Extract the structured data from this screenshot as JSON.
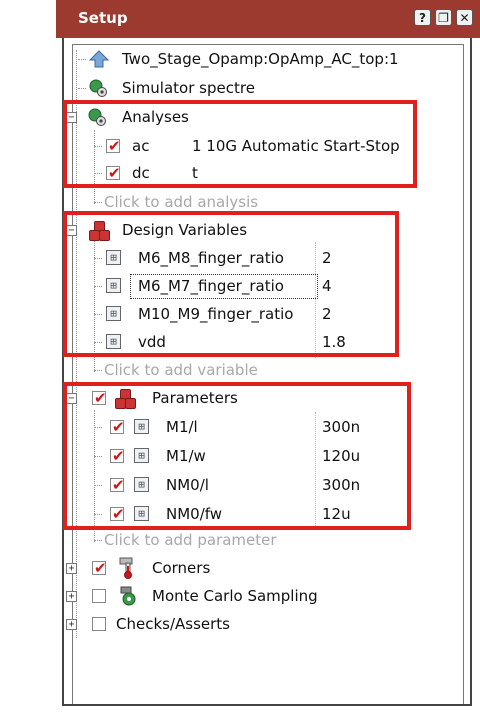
{
  "window": {
    "title": "Setup",
    "buttons": [
      "?",
      "❐",
      "✕"
    ]
  },
  "tree": {
    "testbench": "Two_Stage_Opamp:OpAmp_AC_top:1",
    "simulator": "Simulator spectre",
    "analyses": {
      "label": "Analyses",
      "items": [
        {
          "name": "ac",
          "args": "1 10G Automatic Start-Stop",
          "checked": true
        },
        {
          "name": "dc",
          "args": "t",
          "checked": true
        }
      ],
      "add_hint": "Click to add analysis"
    },
    "design_variables": {
      "label": "Design Variables",
      "items": [
        {
          "name": "M6_M8_finger_ratio",
          "value": "2"
        },
        {
          "name": "M6_M7_finger_ratio",
          "value": "4"
        },
        {
          "name": "M10_M9_finger_ratio",
          "value": "2"
        },
        {
          "name": "vdd",
          "value": "1.8"
        }
      ],
      "add_hint": "Click to add variable"
    },
    "parameters": {
      "label": "Parameters",
      "checked": true,
      "items": [
        {
          "name": "M1/l",
          "value": "300n",
          "checked": true
        },
        {
          "name": "M1/w",
          "value": "120u",
          "checked": true
        },
        {
          "name": "NM0/l",
          "value": "300n",
          "checked": true
        },
        {
          "name": "NM0/fw",
          "value": "12u",
          "checked": true
        }
      ],
      "add_hint": "Click to add parameter"
    },
    "corners": {
      "label": "Corners",
      "checked": true
    },
    "monte_carlo": {
      "label": "Monte Carlo Sampling",
      "checked": false
    },
    "checks": {
      "label": "Checks/Asserts",
      "checked": false
    }
  },
  "colors": {
    "title_bar": "#9d3a2f",
    "highlight": "#e0201c",
    "check": "#d21414",
    "placeholder": "#a8a8a8"
  },
  "icons": {
    "testbench": "up-arrow-icon",
    "simulator": "gear-globe-icon",
    "analyses": "gear-globe-icon",
    "design_variables": "cubes-icon",
    "parameters": "cubes-icon",
    "corners": "thermometer-icon",
    "monte_carlo": "dice-icon",
    "variable": "variable-icon"
  }
}
